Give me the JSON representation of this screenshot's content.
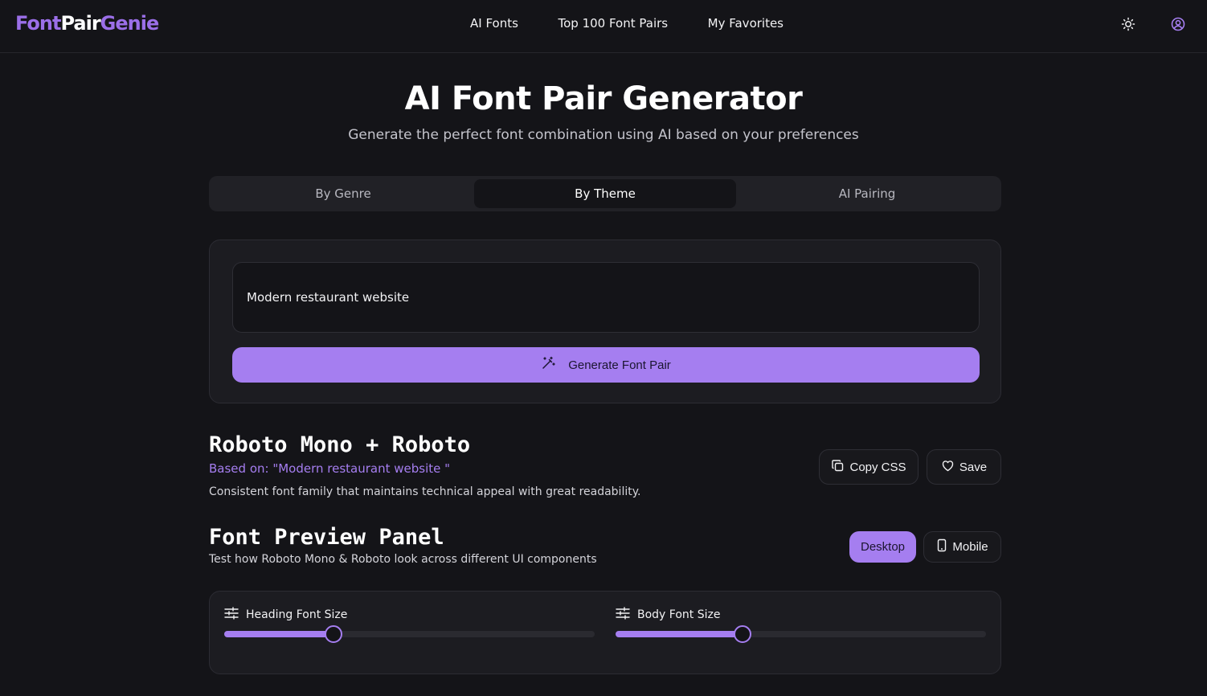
{
  "brand": {
    "part1": "Font",
    "part2": "Pair",
    "part3": "Genie"
  },
  "nav": {
    "links": [
      "AI Fonts",
      "Top 100 Font Pairs",
      "My Favorites"
    ],
    "theme_icon": "sun-icon",
    "account_icon": "user-circle-icon"
  },
  "hero": {
    "title": "AI Font Pair Generator",
    "subtitle": "Generate the perfect font combination using AI based on your preferences"
  },
  "tabs": {
    "items": [
      "By Genre",
      "By Theme",
      "AI Pairing"
    ],
    "active": "By Theme"
  },
  "generator": {
    "input_value": "Modern restaurant website",
    "button_label": "Generate Font Pair",
    "button_icon": "magic-wand-icon"
  },
  "result": {
    "title": "Roboto Mono + Roboto",
    "based_on": "Based on: \"Modern restaurant website \"",
    "description": "Consistent font family that maintains technical appeal with great readability.",
    "copy_label": "Copy CSS",
    "save_label": "Save"
  },
  "preview": {
    "title": "Font Preview Panel",
    "subtitle": "Test how Roboto Mono & Roboto look across different UI components",
    "desktop_label": "Desktop",
    "mobile_label": "Mobile",
    "active_view": "Desktop"
  },
  "sliders": {
    "heading": {
      "label": "Heading Font Size",
      "level_percent": 29.5
    },
    "body": {
      "label": "Body Font Size",
      "level_percent": 34.3
    }
  },
  "colors": {
    "accent": "#a57ef0",
    "background": "#141418",
    "card": "#1c1c21"
  }
}
